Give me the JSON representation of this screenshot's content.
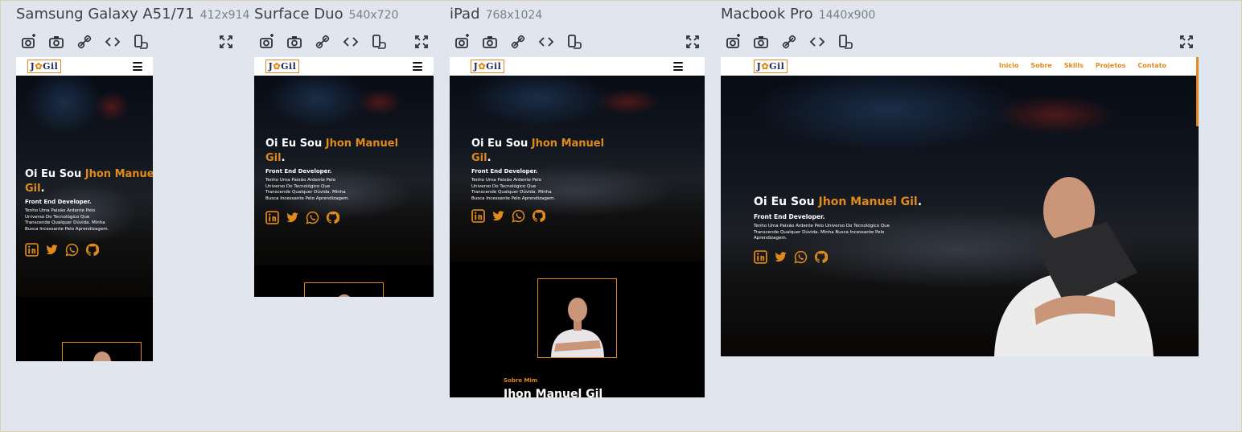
{
  "toolbar_icons": [
    "screenshot-settings-icon",
    "camera-icon",
    "link-icon",
    "code-icon",
    "rotate-icon",
    "fullscreen-icon"
  ],
  "accent_color": "#e08a1e",
  "devices": [
    {
      "name": "Samsung Galaxy A51/71",
      "size": "412x914"
    },
    {
      "name": "Surface Duo",
      "size": "540x720"
    },
    {
      "name": "iPad",
      "size": "768x1024"
    },
    {
      "name": "Macbook Pro",
      "size": "1440x900"
    }
  ],
  "site": {
    "logo": {
      "left": "J",
      "mid": "✿",
      "right": "Gil"
    },
    "nav": [
      "Inicio",
      "Sobre",
      "Skills",
      "Projetos",
      "Contato"
    ],
    "hero": {
      "greeting": "Oi Eu Sou ",
      "name": "Jhon Manuel Gil",
      "name_part1": "Jhon Manuel",
      "name_part2": "Gil",
      "period": ".",
      "role": "Front End Developer.",
      "desc_mobile_1": "Tenho Uma Paixão Ardente Pelo",
      "desc_mobile_2": "Universo Do Tecnológico Que",
      "desc_mobile_3": "Transcende Qualquer Dúvida. Minha",
      "desc_mobile_4": "Busca Incessante Pelo Aprendizagem.",
      "desc_desktop_1": "Tenho Uma Paixão Ardente Pelo Universo Do Tecnológico Que",
      "desc_desktop_2": "Transcende Qualquer Dúvida. Minha Busca Incessante Pelo",
      "desc_desktop_3": "Aprendizagem."
    },
    "socials": [
      "linkedin-icon",
      "twitter-icon",
      "whatsapp-icon",
      "github-icon"
    ],
    "about": {
      "tag": "Sobre Mim",
      "name": "Jhon Manuel Gil"
    }
  }
}
